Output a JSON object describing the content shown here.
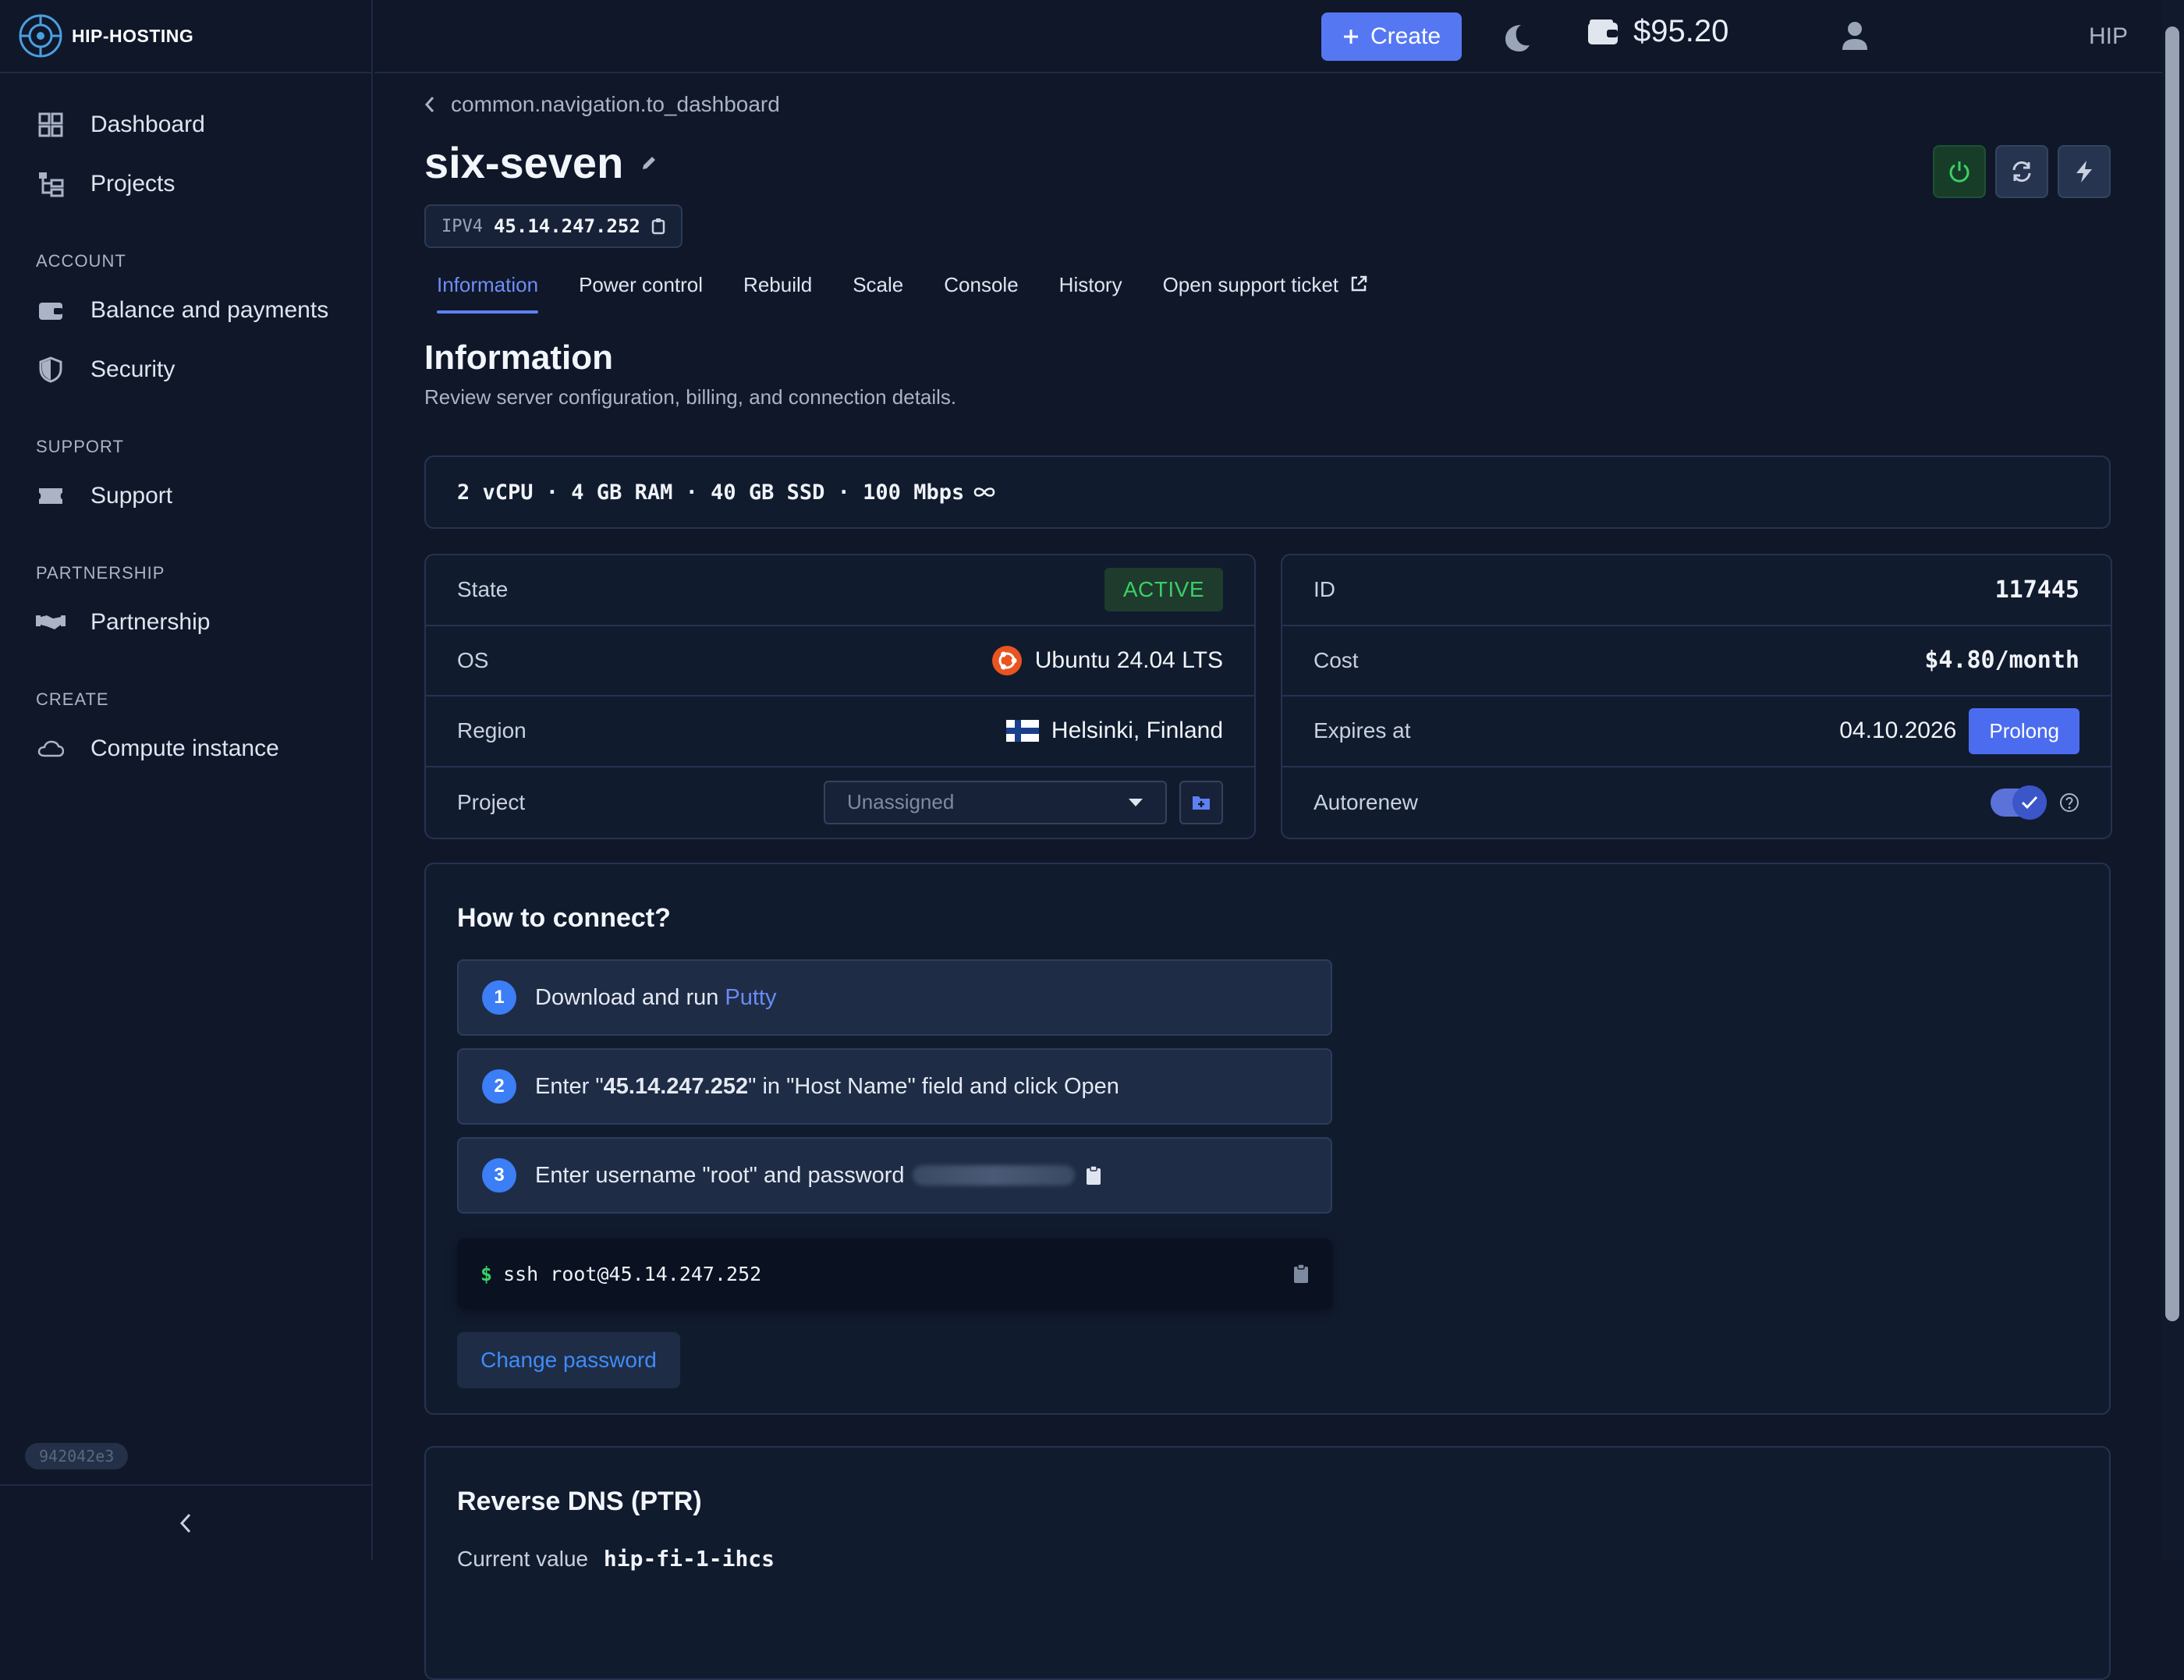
{
  "brand": {
    "name": "HIP-HOSTING"
  },
  "sidebar": {
    "items_top": [
      {
        "label": "Dashboard",
        "icon": "dashboard-icon"
      },
      {
        "label": "Projects",
        "icon": "projects-icon"
      }
    ],
    "sections": [
      {
        "title": "ACCOUNT",
        "items": [
          {
            "label": "Balance and payments",
            "icon": "wallet-icon"
          },
          {
            "label": "Security",
            "icon": "shield-icon"
          }
        ]
      },
      {
        "title": "SUPPORT",
        "items": [
          {
            "label": "Support",
            "icon": "ticket-icon"
          }
        ]
      },
      {
        "title": "PARTNERSHIP",
        "items": [
          {
            "label": "Partnership",
            "icon": "handshake-icon"
          }
        ]
      },
      {
        "title": "CREATE",
        "items": [
          {
            "label": "Compute instance",
            "icon": "cloud-icon"
          }
        ]
      }
    ],
    "version": "942042e3"
  },
  "topbar": {
    "create_label": "Create",
    "balance": "$95.20",
    "user_label": "HIP"
  },
  "page": {
    "back_label": "common.navigation.to_dashboard",
    "title": "six-seven",
    "ip_label": "IPV4",
    "ip_value": "45.14.247.252",
    "tabs": [
      "Information",
      "Power control",
      "Rebuild",
      "Scale",
      "Console",
      "History",
      "Open support ticket"
    ],
    "active_tab": "Information",
    "heading": "Information",
    "subheading": "Review server configuration, billing, and connection details.",
    "specs": "2 vCPU · 4 GB RAM · 40 GB SSD · 100 Mbps"
  },
  "details_left": {
    "state_label": "State",
    "state_value": "ACTIVE",
    "os_label": "OS",
    "os_value": "Ubuntu 24.04 LTS",
    "region_label": "Region",
    "region_value": "Helsinki, Finland",
    "project_label": "Project",
    "project_placeholder": "Unassigned"
  },
  "details_right": {
    "id_label": "ID",
    "id_value": "117445",
    "cost_label": "Cost",
    "cost_value": "$4.80/month",
    "expires_label": "Expires at",
    "expires_value": "04.10.2026",
    "prolong_label": "Prolong",
    "autorenew_label": "Autorenew",
    "autorenew_on": true
  },
  "connect": {
    "title": "How to connect?",
    "step1_num": "1",
    "step1_text": "Download and run",
    "step1_link": "Putty",
    "step2_num": "2",
    "step2_pre": "Enter \"",
    "step2_ip": "45.14.247.252",
    "step2_post": "\" in \"Host Name\" field and click Open",
    "step3_num": "3",
    "step3_text": "Enter username \"root\" and password",
    "command_prompt": "$",
    "command": "ssh root@45.14.247.252",
    "change_password_label": "Change password"
  },
  "rdns": {
    "title": "Reverse DNS (PTR)",
    "current_label": "Current value",
    "current_value": "hip-fi-1-ihcs"
  },
  "colors": {
    "accent": "#5578f2",
    "active_green": "#3ad065",
    "background": "#0f1729"
  }
}
